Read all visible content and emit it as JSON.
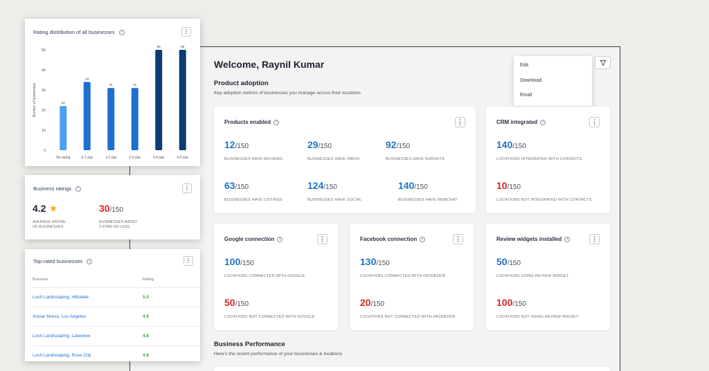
{
  "welcome": "Welcome, Raynil Kumar",
  "product_adoption": {
    "title": "Product adoption",
    "subtitle": "Key adoption metrics of businesses you manage across their locations"
  },
  "menu": {
    "items": [
      "Edit",
      "Download",
      "Email"
    ]
  },
  "products_enabled": {
    "title": "Products enabled",
    "metrics": [
      {
        "value": "12",
        "den": "/150",
        "label": "BUSINESSES HAVE REVIEWS"
      },
      {
        "value": "29",
        "den": "/150",
        "label": "BUSINESSES HAVE INBOX"
      },
      {
        "value": "92",
        "den": "/150",
        "label": "BUSINESSES HAVE SURVEYS"
      },
      {
        "value": "63",
        "den": "/150",
        "label": "BUSINESSES HAVE LISTINGS"
      },
      {
        "value": "124",
        "den": "/150",
        "label": "BUSINESSES HAVE SOCIAL"
      },
      {
        "value": "140",
        "den": "/150",
        "label": "BUSINESSES HAVE WEBCHAT"
      }
    ]
  },
  "crm": {
    "title": "CRM integrated",
    "metrics": [
      {
        "value": "140",
        "den": "/150",
        "label": "LOCATIONS INTEGRATED WITH CONTACTS"
      },
      {
        "value": "10",
        "den": "/150",
        "label": "LOCATIONS NOT INTEGRATED WITH CONTACTS"
      }
    ]
  },
  "google": {
    "title": "Google connection",
    "metrics": [
      {
        "value": "100",
        "den": "/150",
        "label": "LOCATIONS CONNECTED WITH GOOGLE"
      },
      {
        "value": "50",
        "den": "/150",
        "label": "LOCATIONS NOT CONNECTED WITH GOOGLE"
      }
    ]
  },
  "facebook": {
    "title": "Facebook connection",
    "metrics": [
      {
        "value": "130",
        "den": "/150",
        "label": "LOCATIONS CONNECTED WITH FACEBOOK"
      },
      {
        "value": "20",
        "den": "/150",
        "label": "LOCATIONS NOT CONNECTED WITH FACEBOOK"
      }
    ]
  },
  "widgets": {
    "title": "Review widgets installed",
    "metrics": [
      {
        "value": "50",
        "den": "/150",
        "label": "LOCATIONS USING REVIEW WIDGET"
      },
      {
        "value": "100",
        "den": "/150",
        "label": "LOCATIONS NOT USING REVIEW WIDGET"
      }
    ]
  },
  "business_performance": {
    "title": "Business Performance",
    "subtitle": "Here's the recent performance of your businesses & locations"
  },
  "rating_dist": {
    "title": "Rating distribution of all businesses"
  },
  "chart_data": {
    "type": "bar",
    "title": "Rating distribution of all businesses",
    "ylabel": "Number of businesses",
    "xlabel": "",
    "categories": [
      "No rating",
      "0-1 star",
      "1-2 star",
      "2-3 star",
      "3-4 star",
      "4-5 star"
    ],
    "values": [
      22,
      34,
      31,
      31,
      50,
      50
    ],
    "ylim": [
      0,
      50
    ],
    "yticks": [
      0,
      10,
      20,
      30,
      40,
      50
    ],
    "colors": [
      "#4a9ff0",
      "#1f6fd0",
      "#1f6fd0",
      "#1f6fd0",
      "#0d3b73",
      "#0d3b73"
    ],
    "grid": false
  },
  "business_ratings": {
    "title": "Business ratings",
    "avg_value": "4.2",
    "avg_label_1": "AVERAGE RATING",
    "avg_label_2": "OF BUSINESSES",
    "low_value": "30",
    "low_den": "/150",
    "low_label_1": "BUSINESSES RATED",
    "low_label_2": "3 STAR OR LESS"
  },
  "top_rated": {
    "title": "Top-rated businesses",
    "col_business": "Business",
    "col_rating": "Rating",
    "rows": [
      {
        "name": "Lush Landscaping, Hillsdale",
        "rating": "5.0"
      },
      {
        "name": "Social Stress, Los Angeles",
        "rating": "4.9"
      },
      {
        "name": "Lush Landscaping, Lakeview",
        "rating": "4.8"
      },
      {
        "name": "Lush Landscaping, Rose City",
        "rating": "4.8"
      }
    ]
  },
  "colors": {
    "accent_blue": "#1f73c9",
    "alert_red": "#d62727",
    "rating_green": "#3aa340",
    "star": "#f2b01e"
  }
}
